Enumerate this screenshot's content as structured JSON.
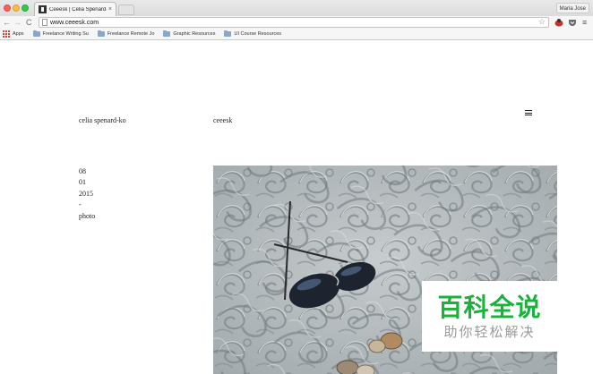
{
  "browser": {
    "tab_title": "Ceeesk | Celia Spenard-Ko",
    "tab_close": "×",
    "profile_name": "Maria Jose",
    "url": "www.ceeesk.com",
    "nav": {
      "back": "←",
      "forward": "→",
      "reload": "C"
    },
    "star": "☆",
    "menu": "≡"
  },
  "bookmarks": {
    "apps": "Apps",
    "items": [
      {
        "label": "Freelance Writing Su"
      },
      {
        "label": "Freelance Remote Jo"
      },
      {
        "label": "Graphic Resources"
      },
      {
        "label": "UI Course Resources"
      }
    ]
  },
  "site": {
    "name": "celia spenard-ko",
    "link": "ceeesk"
  },
  "post_meta": {
    "month": "08",
    "day": "01",
    "year": "2015",
    "separator": "-",
    "category": "photo"
  },
  "photo": {
    "subject": "sunglasses on carved stone relief with coins"
  },
  "watermark": {
    "main": "百科全说",
    "sub": "助你轻松解决"
  },
  "colors": {
    "watermark_green": "#19b23b",
    "stone_base": "#b9c0c2"
  }
}
